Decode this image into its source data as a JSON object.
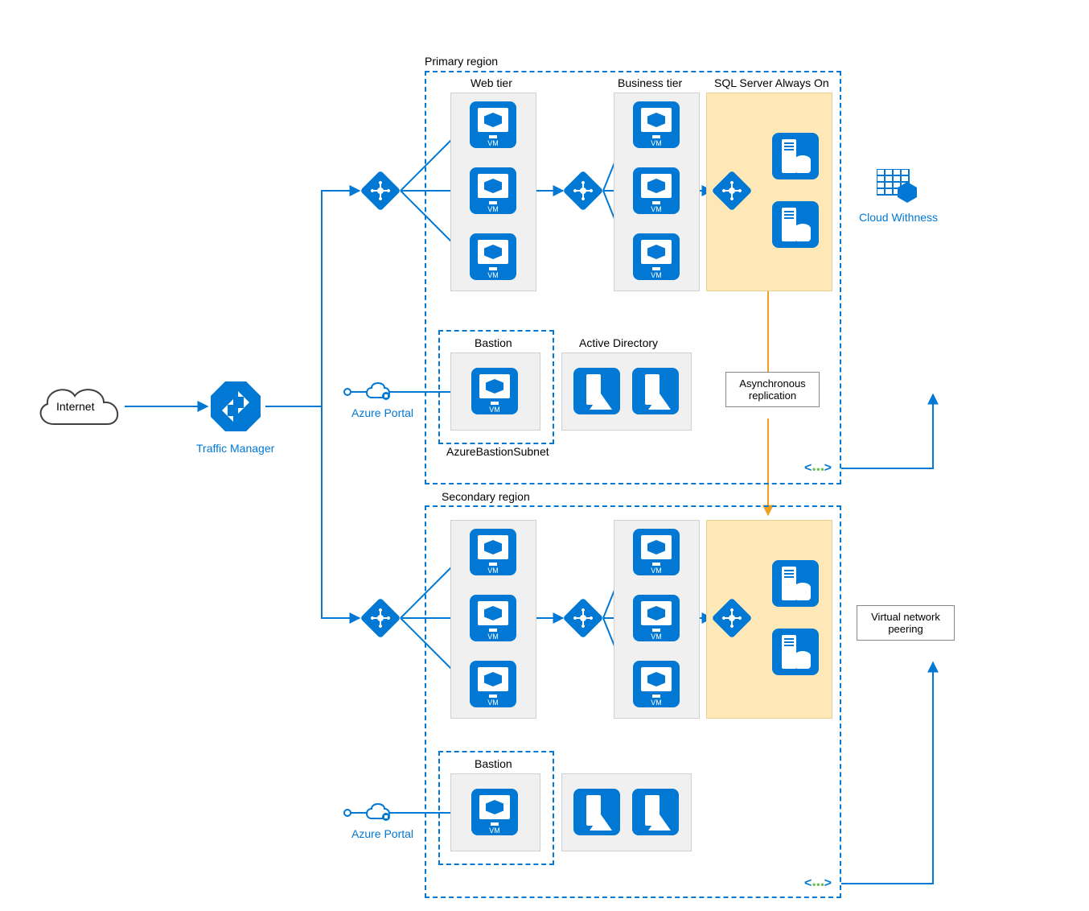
{
  "external": {
    "internet_label": "Internet",
    "traffic_manager_label": "Traffic Manager",
    "cloud_witness_label": "Cloud Withness"
  },
  "azure_portal_label": "Azure Portal",
  "primary": {
    "region_label": "Primary region",
    "web_tier_label": "Web tier",
    "business_tier_label": "Business tier",
    "sql_label": "SQL Server Always On",
    "bastion_label": "Bastion",
    "bastion_subnet_label": "AzureBastionSubnet",
    "active_directory_label": "Active Directory",
    "vm_label": "VM"
  },
  "secondary": {
    "region_label": "Secondary region",
    "bastion_label": "Bastion",
    "vm_label": "VM"
  },
  "annotations": {
    "async_replication": "Asynchronous replication",
    "vnet_peering": "Virtual network peering"
  }
}
